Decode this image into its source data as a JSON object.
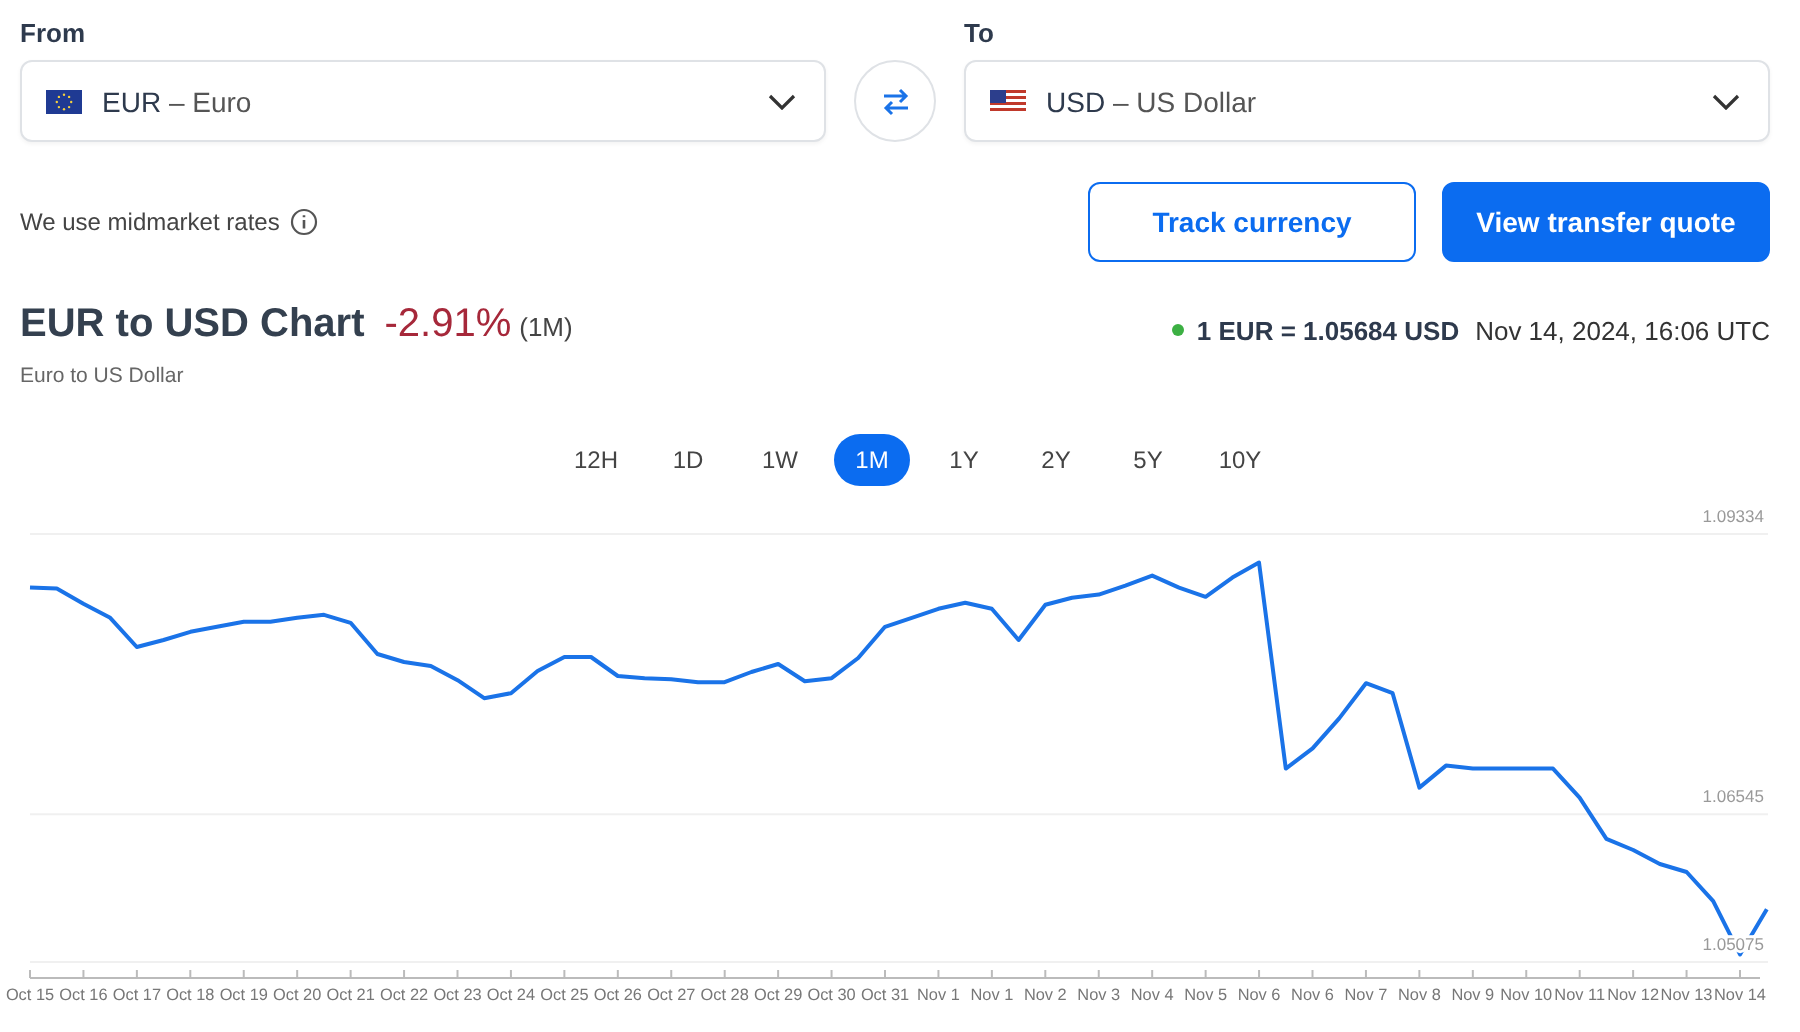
{
  "converter": {
    "from": {
      "label": "From",
      "code": "EUR",
      "name": "– Euro"
    },
    "to": {
      "label": "To",
      "code": "USD",
      "name": "– US Dollar"
    }
  },
  "rates_note": "We use midmarket rates",
  "buttons": [
    {
      "label": "Track currency",
      "kind": "outline"
    },
    {
      "label": "View transfer quote",
      "kind": "filled"
    }
  ],
  "chart_header": {
    "title": "EUR to USD Chart",
    "change": "-2.91%",
    "period": "(1M)",
    "subtitle": "Euro to US Dollar",
    "rate": "1 EUR = 1.05684 USD",
    "timestamp": "Nov 14, 2024, 16:06 UTC"
  },
  "ranges": [
    {
      "label": "12H",
      "selected": false
    },
    {
      "label": "1D",
      "selected": false
    },
    {
      "label": "1W",
      "selected": false
    },
    {
      "label": "1M",
      "selected": true
    },
    {
      "label": "1Y",
      "selected": false
    },
    {
      "label": "2Y",
      "selected": false
    },
    {
      "label": "5Y",
      "selected": false
    },
    {
      "label": "10Y",
      "selected": false
    }
  ],
  "chart_data": {
    "type": "line",
    "categories": [
      "Oct 15",
      null,
      "Oct 16",
      null,
      "Oct 17",
      null,
      "Oct 18",
      null,
      "Oct 19",
      null,
      "Oct 20",
      null,
      "Oct 21",
      null,
      "Oct 22",
      null,
      "Oct 23",
      null,
      "Oct 24",
      null,
      "Oct 25",
      null,
      "Oct 26",
      null,
      "Oct 27",
      null,
      "Oct 28",
      null,
      "Oct 29",
      null,
      "Oct 30",
      null,
      "Oct 31",
      null,
      "Nov 1",
      null,
      "Nov 1",
      null,
      "Nov 2",
      null,
      "Nov 3",
      null,
      "Nov 4",
      null,
      "Nov 5",
      null,
      "Nov 6",
      null,
      "Nov 6",
      null,
      "Nov 7",
      null,
      "Nov 8",
      null,
      "Nov 9",
      null,
      "Nov 10",
      null,
      "Nov 11",
      null,
      "Nov 12",
      null,
      "Nov 13",
      null,
      "Nov 14",
      null
    ],
    "series": [
      {
        "color": "#1a73e8",
        "values": [
          1.088,
          1.0879,
          1.0864,
          1.085,
          1.0821,
          1.0828,
          1.0836,
          1.0841,
          1.0846,
          1.0846,
          1.085,
          1.0853,
          1.0845,
          1.0814,
          1.0806,
          1.0802,
          1.0788,
          1.077,
          1.0775,
          1.0797,
          1.0811,
          1.0811,
          1.0792,
          1.079,
          1.0789,
          1.0786,
          1.0786,
          1.0796,
          1.0804,
          1.0787,
          1.079,
          1.081,
          1.0841,
          1.085,
          1.0859,
          1.0865,
          1.0859,
          1.0828,
          1.0863,
          1.087,
          1.0873,
          1.0882,
          1.0892,
          1.088,
          1.0871,
          1.089,
          1.0905,
          1.07,
          1.072,
          1.075,
          1.0785,
          1.0775,
          1.0681,
          1.0703,
          1.07,
          1.07,
          1.07,
          1.07,
          1.0671,
          1.063,
          1.0619,
          1.0605,
          1.0597,
          1.0568,
          1.0515,
          1.056
        ]
      }
    ],
    "ylim": [
      1.05075,
      1.09334
    ],
    "yticks": [
      {
        "value": 1.09334,
        "label": "1.09334"
      },
      {
        "value": 1.06545,
        "label": "1.06545"
      },
      {
        "value": 1.05075,
        "label": "1.05075"
      }
    ]
  }
}
